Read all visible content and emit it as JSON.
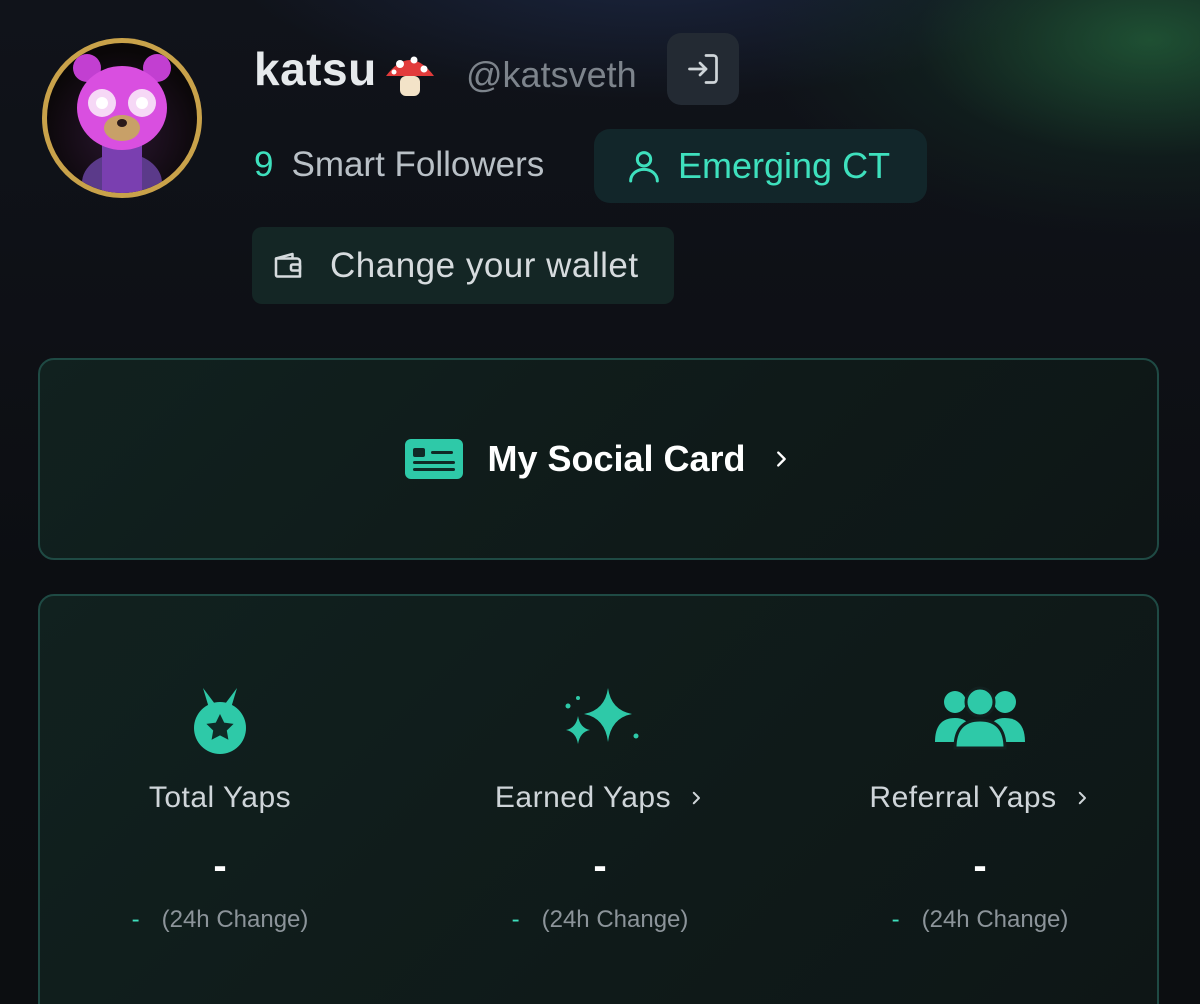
{
  "profile": {
    "name": "katsu",
    "handle": "@katsveth",
    "followers_count": "9",
    "followers_label": "Smart Followers",
    "badge_label": "Emerging CT"
  },
  "actions": {
    "wallet_label": "Change your wallet"
  },
  "social_card": {
    "label": "My Social Card"
  },
  "stats": [
    {
      "label": "Total Yaps",
      "value": "-",
      "change": "-",
      "change_label": "(24h Change)",
      "icon": "medal-icon"
    },
    {
      "label": "Earned Yaps",
      "value": "-",
      "change": "-",
      "change_label": "(24h Change)",
      "icon": "sparkles-icon"
    },
    {
      "label": "Referral Yaps",
      "value": "-",
      "change": "-",
      "change_label": "(24h Change)",
      "icon": "users-icon"
    }
  ],
  "colors": {
    "accent": "#3ee0bd",
    "background": "#0d0f13",
    "card_border": "#1f4a44"
  }
}
